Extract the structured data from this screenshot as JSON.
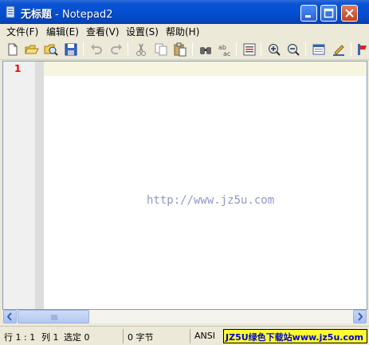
{
  "window": {
    "title": "无标题",
    "title_separator": " - ",
    "app_name": "Notepad2"
  },
  "menu": [
    {
      "label": "文件(F)"
    },
    {
      "label": "编辑(E)"
    },
    {
      "label": "查看(V)"
    },
    {
      "label": "设置(S)"
    },
    {
      "label": "帮助(H)"
    }
  ],
  "toolbar_icons": [
    "new-icon",
    "open-icon",
    "browse-icon",
    "save-icon",
    "undo-icon",
    "redo-icon",
    "cut-icon",
    "copy-icon",
    "paste-icon",
    "find-icon",
    "replace-icon",
    "goto-icon",
    "zoom-in-icon",
    "zoom-out-icon",
    "view-icon",
    "edit-icon",
    "schema-icon"
  ],
  "editor": {
    "line_number": "1",
    "watermark": "http://www.jz5u.com"
  },
  "status": {
    "position": "行 1 : 1",
    "column": "列 1",
    "selection": "选定 0",
    "bytes": "0 字节",
    "encoding": "ANSI",
    "banner": "JZ5U绿色下载站www.jz5u.com"
  },
  "colors": {
    "titlebar": "#0450d2",
    "line_number": "#e00000",
    "watermark": "#8f97cc",
    "banner_bg": "#ffff33",
    "banner_text": "#0000cc"
  }
}
